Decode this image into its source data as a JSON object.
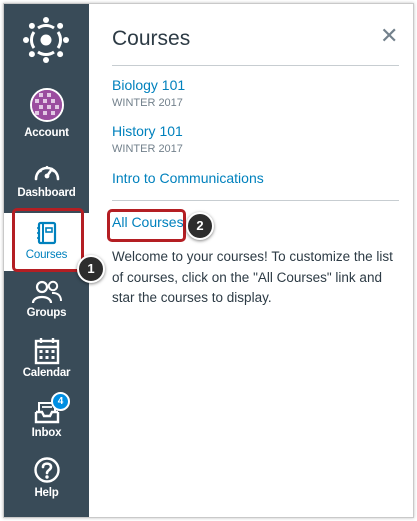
{
  "nav": {
    "items": [
      {
        "label": "Account",
        "icon": "account-avatar"
      },
      {
        "label": "Dashboard",
        "icon": "dashboard-icon"
      },
      {
        "label": "Courses",
        "icon": "courses-icon"
      },
      {
        "label": "Groups",
        "icon": "groups-icon"
      },
      {
        "label": "Calendar",
        "icon": "calendar-icon"
      },
      {
        "label": "Inbox",
        "icon": "inbox-icon",
        "badge": "4"
      },
      {
        "label": "Help",
        "icon": "help-icon"
      }
    ]
  },
  "tray": {
    "title": "Courses",
    "close_icon": "close-icon",
    "courses": [
      {
        "name": "Biology 101",
        "term": "WINTER 2017"
      },
      {
        "name": "History 101",
        "term": "WINTER 2017"
      },
      {
        "name": "Intro to Communications",
        "term": ""
      }
    ],
    "all_courses_label": "All Courses",
    "welcome": "Welcome to your courses! To customize the list of courses, click on the \"All Courses\" link and star the courses to display."
  },
  "callouts": {
    "one": "1",
    "two": "2"
  },
  "colors": {
    "nav_bg": "#394b58",
    "link": "#0081bd",
    "highlight": "#b41e23",
    "badge": "#008ee2"
  }
}
